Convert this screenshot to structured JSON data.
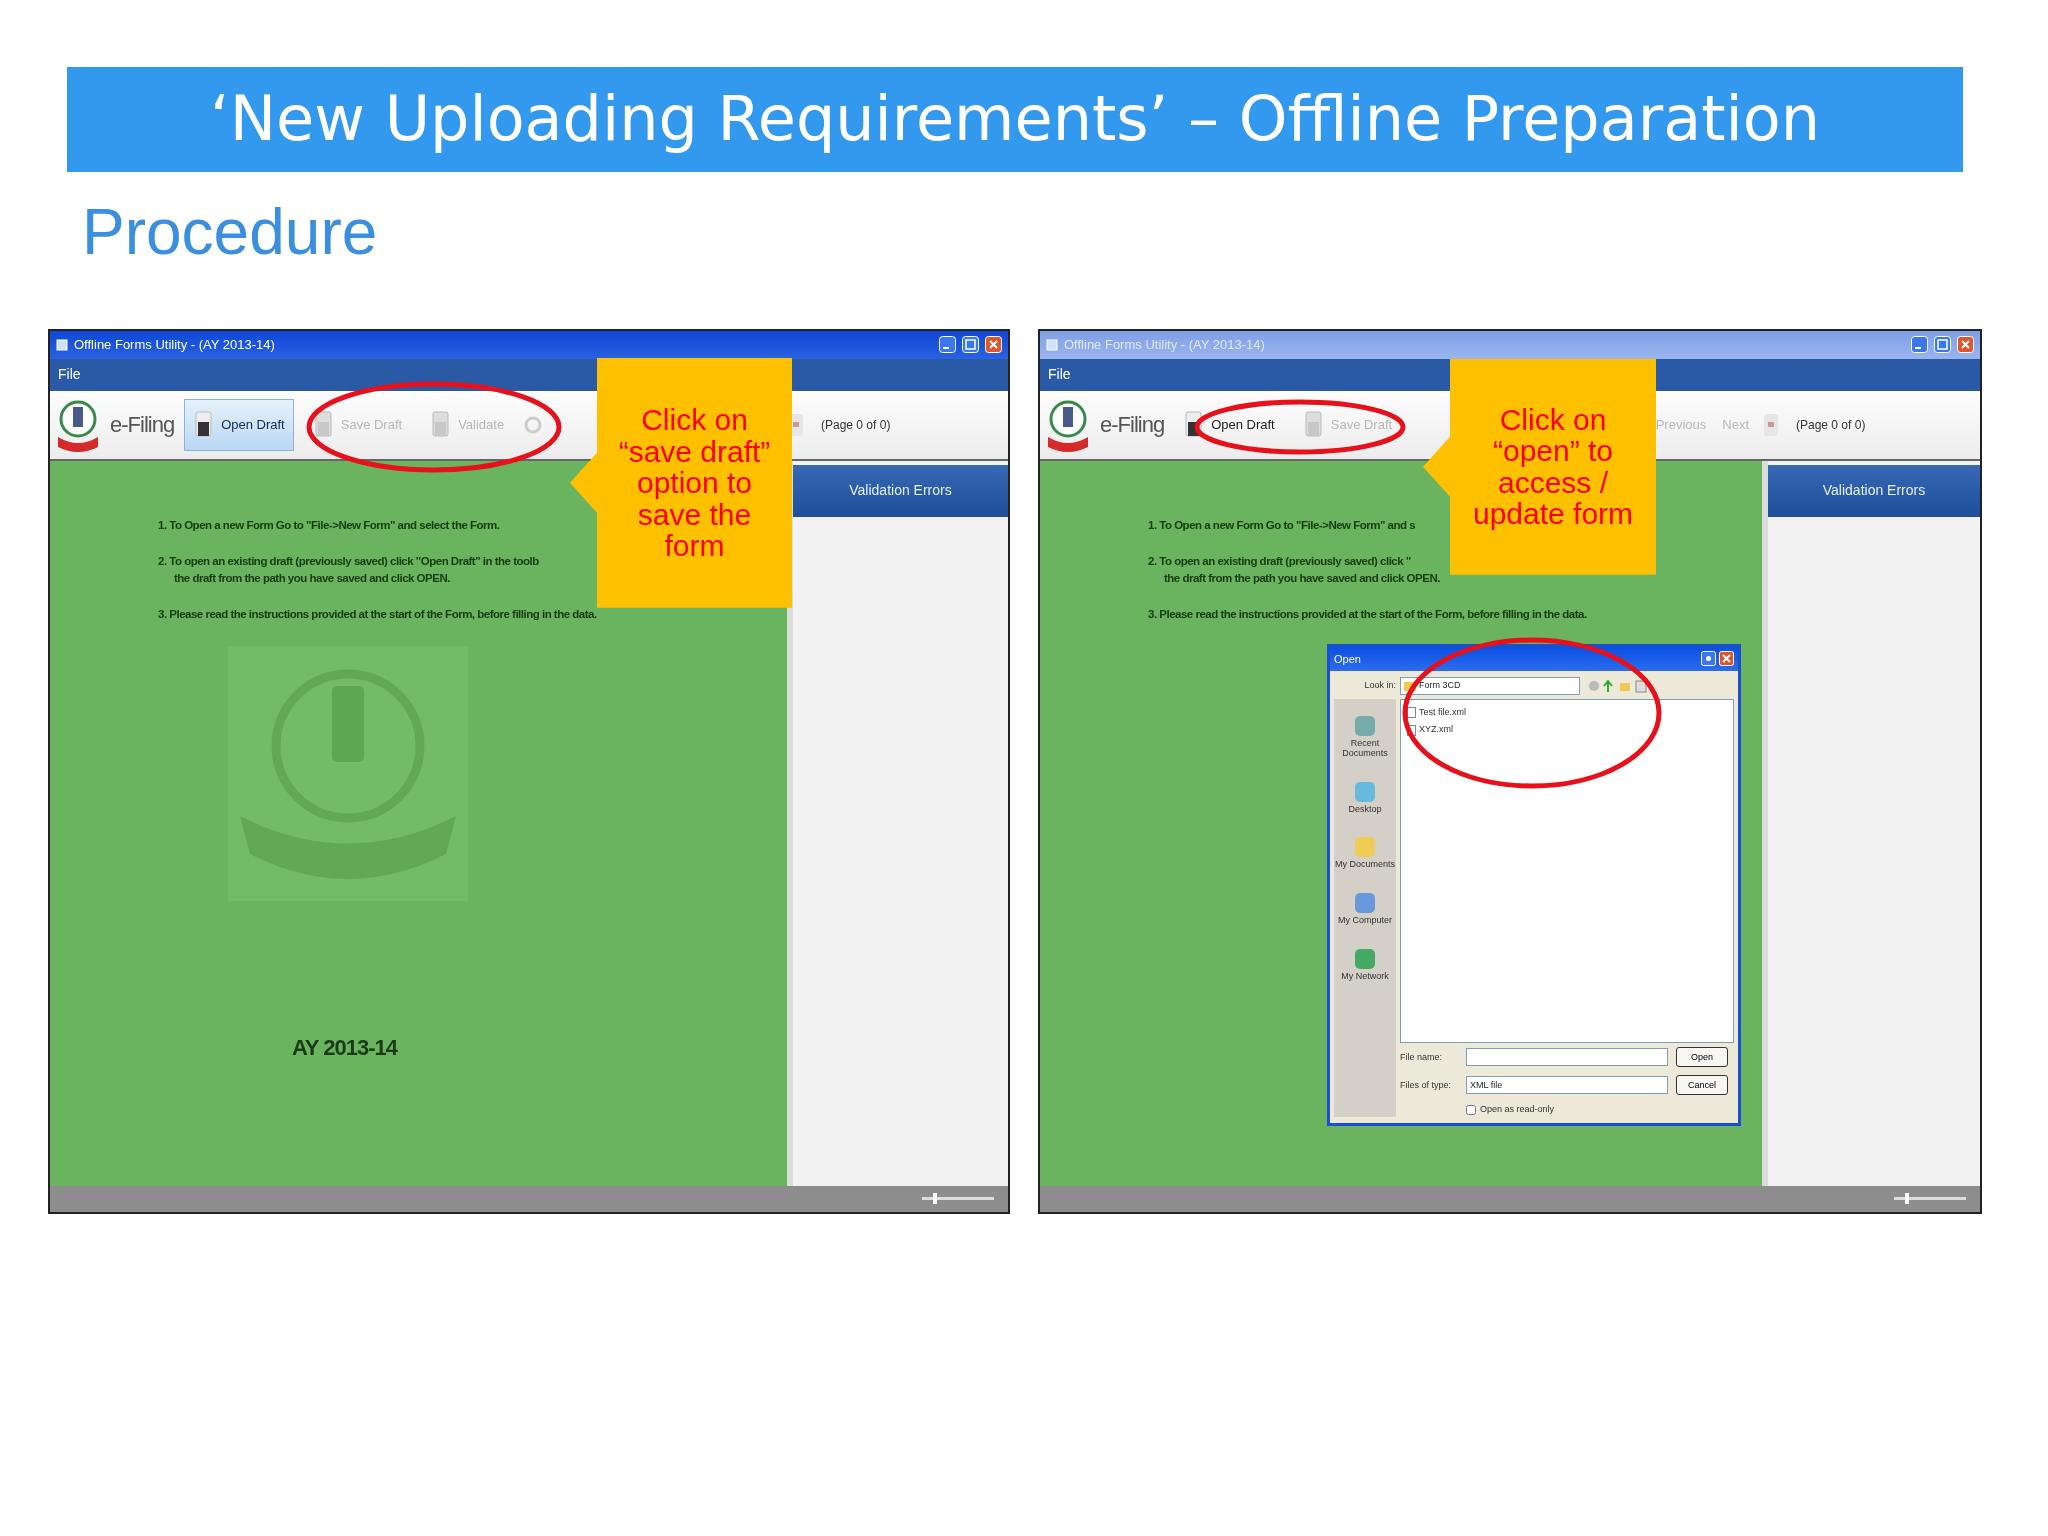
{
  "slide": {
    "title": "‘New Uploading Requirements’ – Offline Preparation",
    "subtitle": "Procedure"
  },
  "screenshots": [
    {
      "window": {
        "title": "Offline Forms Utility - (AY 2013-14)",
        "active": true
      },
      "menu": [
        "File"
      ],
      "toolbar": {
        "brand": "e-Filing",
        "buttons": [
          {
            "label": "Open Draft",
            "pressed": true,
            "disabled": false
          },
          {
            "label": "Save Draft",
            "pressed": false,
            "disabled": true
          },
          {
            "label": "Validate",
            "pressed": false,
            "disabled": true
          }
        ],
        "page_label": "(Page 0 of 0)"
      },
      "instructions": [
        {
          "lines": [
            "1. To Open a new Form Go to \"File->New Form\" and select the Form."
          ]
        },
        {
          "lines": [
            "2. To open an existing draft (previously saved) click \"Open Draft\" in the toolb",
            "the draft from the path you have saved and click OPEN."
          ]
        },
        {
          "lines": [
            "3. Please read the instructions provided at the start of the Form, before filling in the data."
          ]
        }
      ],
      "year": "AY 2013-14",
      "panel_title": "Validation Errors",
      "zoom": {
        "level": 0.15
      },
      "callout": "Click on “save draft” option to save the form"
    },
    {
      "window": {
        "title": "Offline Forms Utility - (AY 2013-14)",
        "active": false
      },
      "menu": [
        "File"
      ],
      "toolbar": {
        "brand": "e-Filing",
        "buttons": [
          {
            "label": "Open Draft",
            "pressed": false,
            "disabled": false
          },
          {
            "label": "Save Draft",
            "pressed": false,
            "disabled": true
          }
        ],
        "nav_buttons": [
          {
            "label": "Previous",
            "disabled": true
          },
          {
            "label": "Next",
            "disabled": true
          }
        ],
        "page_label": "(Page 0 of 0)"
      },
      "instructions": [
        {
          "lines": [
            "1. To Open a new Form Go to \"File->New Form\" and s"
          ]
        },
        {
          "lines": [
            "2. To open an existing draft (previously saved) click \"",
            "the draft from the path you have saved and click OPEN."
          ]
        },
        {
          "lines": [
            "3. Please read the instructions provided at the start of the Form, before filling in the data."
          ]
        }
      ],
      "panel_title": "Validation Errors",
      "zoom": {
        "level": 0.15
      },
      "dialog": {
        "title": "Open",
        "look_in_label": "Look in:",
        "look_in": "Form 3CD",
        "places": [
          "Recent Documents",
          "Desktop",
          "My Documents",
          "My Computer",
          "My Network"
        ],
        "files": [
          "Test file.xml",
          "XYZ.xml"
        ],
        "file_name_label": "File name:",
        "file_type_label": "Files of type:",
        "file_type": "XML file",
        "buttons": [
          "Open",
          "Cancel"
        ],
        "read_only": {
          "label": "Open as read-only",
          "checked": false
        }
      },
      "callout": "Click on “open” to access / update form"
    }
  ]
}
